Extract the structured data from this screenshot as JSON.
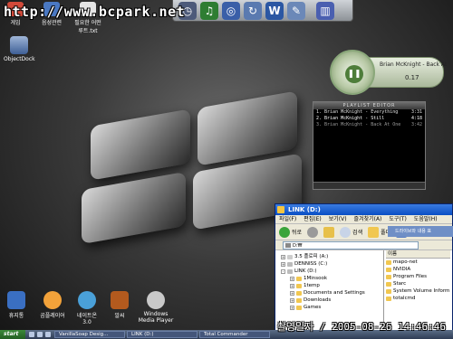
{
  "watermark": "http://www.bcpark.net",
  "top_icons": [
    {
      "label": "게임",
      "color": "#d24a3a"
    },
    {
      "label": "음성관련",
      "color": "#4a78c2"
    },
    {
      "label": "필요한 어떤 루트.txt",
      "color": "#e5e5e5"
    }
  ],
  "dock_icons": [
    {
      "icon": "clock-icon",
      "color": "#4d5a7a"
    },
    {
      "icon": "media-icon",
      "color": "#2e7d32"
    },
    {
      "icon": "globe-icon",
      "color": "#3a5fa8"
    },
    {
      "icon": "refresh-icon",
      "color": "#5a7ab0"
    },
    {
      "icon": "word-icon",
      "color": "#2b57a3"
    },
    {
      "icon": "tools-icon",
      "color": "#6b88b8"
    },
    {
      "icon": "recycle-bin-icon",
      "color": "#4a5fb0"
    }
  ],
  "desktop_icons": {
    "objectdock": "ObjectDock",
    "bottom": [
      {
        "label": "휴지통",
        "color": "#3a6fc2"
      },
      {
        "label": "곰플레이어",
        "color": "#f2a23a"
      },
      {
        "label": "네이트온 3.0",
        "color": "#4aa0d8"
      },
      {
        "label": "알씨",
        "color": "#b35a1e"
      },
      {
        "label": "Windows Media Player",
        "color": "#c9c9c9"
      }
    ]
  },
  "player": {
    "track": "Brian McKnight - Back At",
    "time": "0.17"
  },
  "playlist": {
    "title": "PLAYLIST EDITOR",
    "items": [
      {
        "name": "1. Brian McKnight - Everything",
        "dur": "3:31"
      },
      {
        "name": "2. Brian McKnight - Still",
        "dur": "4:18"
      },
      {
        "name": "3. Brian McKnight - Back At One",
        "dur": "3:42"
      }
    ]
  },
  "explorer": {
    "title": "LINK (D:)",
    "menu": [
      "파일(F)",
      "편집(E)",
      "보기(V)",
      "즐겨찾기(A)",
      "도구(T)",
      "도움말(H)"
    ],
    "toolbar": {
      "back": "뒤로",
      "search": "검색",
      "folders": "폴더"
    },
    "address": "D:₩",
    "tree": [
      {
        "label": "3.5 플로피 (A:)",
        "indent": 1
      },
      {
        "label": "DENNISS (C:)",
        "indent": 1
      },
      {
        "label": "LINK (D:)",
        "indent": 1
      },
      {
        "label": "1Minsook",
        "indent": 2
      },
      {
        "label": "1temp",
        "indent": 2
      },
      {
        "label": "Documents and Settings",
        "indent": 2
      },
      {
        "label": "Downloads",
        "indent": 2
      },
      {
        "label": "Games",
        "indent": 2
      }
    ],
    "list_header": "이름",
    "list": [
      "mapo-net",
      "NVIDIA",
      "Program Files",
      "Starc",
      "System Volume Inform",
      "totalcmd"
    ]
  },
  "side_tab": "드라이브와 내용 표",
  "taskbar": {
    "start": "start",
    "tasks": [
      "VanillaSoap Desig...",
      "LINK (D:)",
      "Total Commander"
    ]
  },
  "stamp": "촬영일자 / 2005-08-26 14:46:46"
}
